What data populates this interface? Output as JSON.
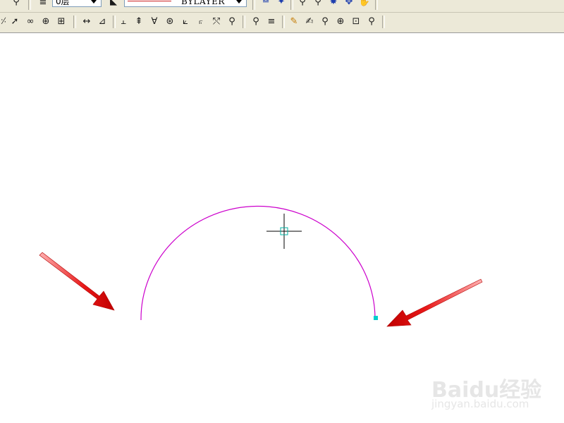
{
  "toolbar_layers": {
    "layer_value": "0层",
    "linetype_value": "BYLAYER"
  },
  "toolbar_icons_row1": [
    "layer-manager-icon",
    "layer-states-icon",
    "object-color-icon",
    "linetype-icon",
    "block-insert-icon",
    "match-properties-icon",
    "pan-icon",
    "zoom-realtime-icon",
    "zoom-window-icon",
    "zoom-previous-icon"
  ],
  "toolbar_icons_row2": [
    "polyline-icon",
    "spline-icon",
    "revision-cloud-icon",
    "hatch-icon",
    "boundary-icon",
    "linear-dimension-icon",
    "aligned-dimension-icon",
    "arc-length-icon",
    "ordinate-icon",
    "radius-icon",
    "diameter-icon",
    "angular-icon",
    "baseline-icon",
    "continue-icon",
    "tolerance-icon",
    "center-mark-icon",
    "quick-select-icon",
    "measure-icon",
    "edit-text-icon",
    "zoom-in-icon",
    "zoom-out-icon",
    "zoom-all-icon",
    "zoom-extents-icon"
  ],
  "canvas": {
    "arc_color": "#cc00cc",
    "grip_color": "#00cccc",
    "arrow_color": "#e01010"
  },
  "watermark": {
    "logo": "Baidu经验",
    "url": "jingyan.baidu.com"
  }
}
